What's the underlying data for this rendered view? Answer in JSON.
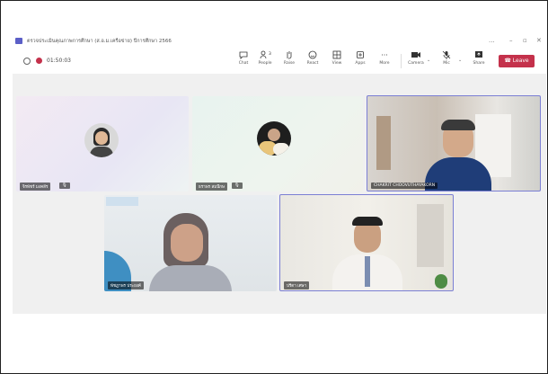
{
  "window": {
    "title": "ตรวจประเมินคุณภาพการศึกษา (ส.อ.ม.เครือข่าย) ปีการศึกษา 2566",
    "controls": {
      "more": "...",
      "minimize": "–",
      "restore": "▫",
      "close": "✕"
    }
  },
  "meeting": {
    "timer": "01:50:03"
  },
  "toolbar": {
    "chat": "Chat",
    "people": "People",
    "people_count": "3",
    "raise": "Raise",
    "react": "React",
    "view": "View",
    "apps": "Apps",
    "more": "More",
    "camera": "Camera",
    "mic": "Mic",
    "share": "Share",
    "leave": "Leave"
  },
  "participants": [
    {
      "name": "จิรพัชร์ มงคลีร"
    },
    {
      "name": "ธราพร สมนึกษ"
    },
    {
      "name": "CHAKRIT CHOOVUTHAYAKORN"
    },
    {
      "name": "พัชฎาพร ประยงค์"
    },
    {
      "name": "ปรีดา เศษา"
    }
  ],
  "colors": {
    "leave": "#c4314b",
    "active_border": "#7b7fd4",
    "accent": "#5b5fc7"
  }
}
